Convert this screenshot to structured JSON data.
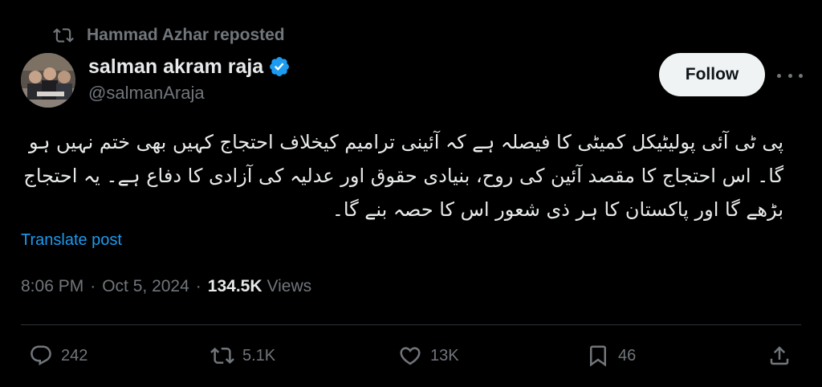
{
  "repost": {
    "icon": "repost-icon",
    "text": "Hammad Azhar reposted"
  },
  "author": {
    "display_name": "salman akram raja",
    "verified_icon": "verified-badge-icon",
    "verified_color": "#1d9bf0",
    "handle": "@salmanAraja"
  },
  "follow_button": {
    "label": "Follow"
  },
  "more_icon": "more-horizontal-icon",
  "tweet": {
    "text": "پی ٹی آئی پولیٹیکل کمیٹی کا فیصلہ ہے کہ آئینی ترامیم کیخلاف احتجاج کہیں بھی ختم نہیں ہو گا۔ اس احتجاج کا مقصد آئین کی روح، بنیادی حقوق اور عدلیہ کی آزادی کا دفاع ہے۔ یہ احتجاج بڑھے گا اور پاکستان کا ہر ذی شعور اس کا حصہ بنے گا۔",
    "translate_label": "Translate post",
    "time": "8:06 PM",
    "date": "Oct 5, 2024",
    "views_count": "134.5K",
    "views_label": "Views",
    "meta_separator": "·"
  },
  "actions": {
    "replies": {
      "icon": "reply-icon",
      "count": "242"
    },
    "reposts": {
      "icon": "repost-icon",
      "count": "5.1K"
    },
    "likes": {
      "icon": "heart-icon",
      "count": "13K"
    },
    "bookmarks": {
      "icon": "bookmark-icon",
      "count": "46"
    },
    "share": {
      "icon": "share-icon"
    }
  },
  "colors": {
    "background": "#000000",
    "text_primary": "#e7e9ea",
    "text_secondary": "#71767b",
    "link": "#1d9bf0",
    "divider": "#2f3336",
    "follow_bg": "#eff3f4"
  }
}
